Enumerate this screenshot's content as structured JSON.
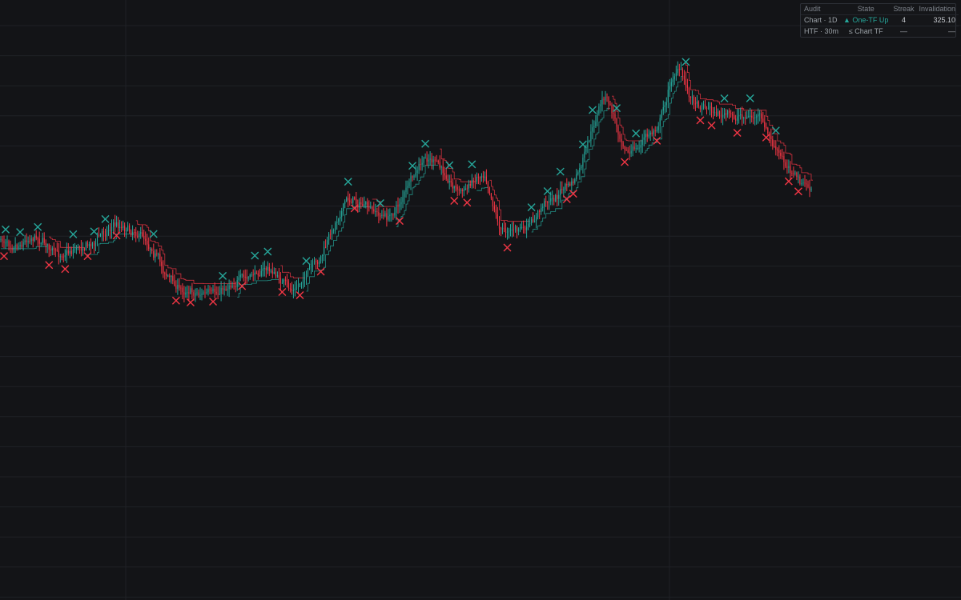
{
  "theme": {
    "background": "#131417",
    "grid": "#1f2126",
    "up_color": "#26a69a",
    "down_color": "#f23645",
    "text_muted": "#9aa0a6"
  },
  "audit_panel": {
    "headers": {
      "audit": "Audit",
      "state": "State",
      "streak": "Streak",
      "invalidation": "Invalidation"
    },
    "rows": [
      {
        "audit": "Chart · 1D",
        "state": "▲ One-TF Up",
        "streak": "4",
        "invalidation": "325.10"
      },
      {
        "audit": "HTF · 30m",
        "state": "≤ Chart TF",
        "streak": "—",
        "invalidation": "—"
      }
    ]
  },
  "chart_data": {
    "type": "candlestick",
    "title": "",
    "xlabel": "",
    "ylabel": "",
    "grid": true,
    "legend": "none",
    "price_anchors": [
      [
        0,
        300
      ],
      [
        10,
        306
      ],
      [
        20,
        295
      ],
      [
        35,
        318
      ],
      [
        55,
        305
      ],
      [
        70,
        280
      ],
      [
        85,
        292
      ],
      [
        110,
        362
      ],
      [
        130,
        368
      ],
      [
        150,
        348
      ],
      [
        165,
        336
      ],
      [
        180,
        362
      ],
      [
        195,
        332
      ],
      [
        215,
        248
      ],
      [
        240,
        273
      ],
      [
        265,
        195
      ],
      [
        285,
        240
      ],
      [
        300,
        214
      ],
      [
        310,
        288
      ],
      [
        325,
        287
      ],
      [
        340,
        250
      ],
      [
        355,
        229
      ],
      [
        375,
        122
      ],
      [
        390,
        192
      ],
      [
        405,
        164
      ],
      [
        420,
        86
      ],
      [
        430,
        126
      ],
      [
        450,
        145
      ],
      [
        470,
        146
      ],
      [
        485,
        199
      ],
      [
        498,
        233
      ],
      [
        505,
        235
      ]
    ],
    "candle_count": 505,
    "x_markers_up": [
      3,
      12,
      23,
      45,
      58,
      65,
      95,
      138,
      158,
      166,
      190,
      216,
      236,
      256,
      264,
      279,
      293,
      330,
      340,
      348,
      362,
      368,
      383,
      395,
      426,
      450,
      466,
      482
    ],
    "x_markers_down": [
      2,
      30,
      40,
      54,
      72,
      109,
      118,
      132,
      150,
      175,
      186,
      199,
      220,
      248,
      282,
      290,
      315,
      352,
      356,
      388,
      408,
      435,
      442,
      458,
      476,
      490,
      496
    ]
  }
}
